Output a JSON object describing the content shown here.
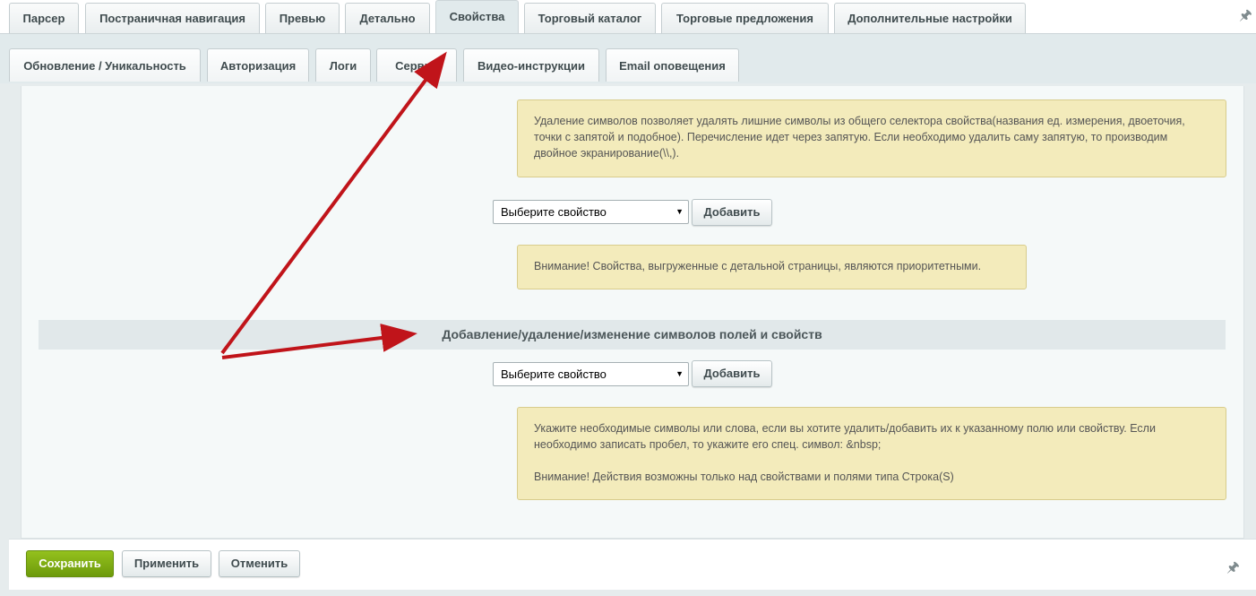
{
  "tabs_row1": [
    {
      "label": "Парсер"
    },
    {
      "label": "Постраничная навигация"
    },
    {
      "label": "Превью"
    },
    {
      "label": "Детально"
    },
    {
      "label": "Свойства",
      "active": true
    },
    {
      "label": "Торговый каталог"
    },
    {
      "label": "Торговые предложения"
    },
    {
      "label": "Дополнительные настройки"
    }
  ],
  "tabs_row2": [
    {
      "label": "Обновление / Уникальность"
    },
    {
      "label": "Авторизация"
    },
    {
      "label": "Логи"
    },
    {
      "label": "Сервис"
    },
    {
      "label": "Видео-инструкции"
    },
    {
      "label": "Email оповещения"
    }
  ],
  "notes": {
    "removal_note": "Удаление символов позволяет удалять лишние символы из общего селектора свойства(названия ед. измерения, двоеточия, точки с запятой и подобное). Перечисление идет через запятую. Если необходимо удалить саму запятую, то производим двойное экранирование(\\\\,).",
    "priority_note": "Внимание! Свойства, выгруженные с детальной страницы, являются приоритетными.",
    "symbols_note_1": "Укажите необходимые символы или слова, если вы хотите удалить/добавить их к указанному полю или свойству. Если необходимо записать пробел, то укажите его спец. символ: &nbsp;",
    "symbols_note_2": "Внимание! Действия возможны только над свойствами и полями типа Строка(S)"
  },
  "select1": {
    "value": "Выберите свойство"
  },
  "select2": {
    "value": "Выберите свойство"
  },
  "add_label": "Добавить",
  "section_title": "Добавление/удаление/изменение символов полей и свойств",
  "footer": {
    "save": "Сохранить",
    "apply": "Применить",
    "cancel": "Отменить"
  },
  "colors": {
    "accent_green": "#7aa813",
    "arrow_red": "#c0141a",
    "note_bg": "#f3ebbb"
  },
  "icons": {
    "pin": "pin-icon",
    "dropdown": "triangle-down"
  }
}
